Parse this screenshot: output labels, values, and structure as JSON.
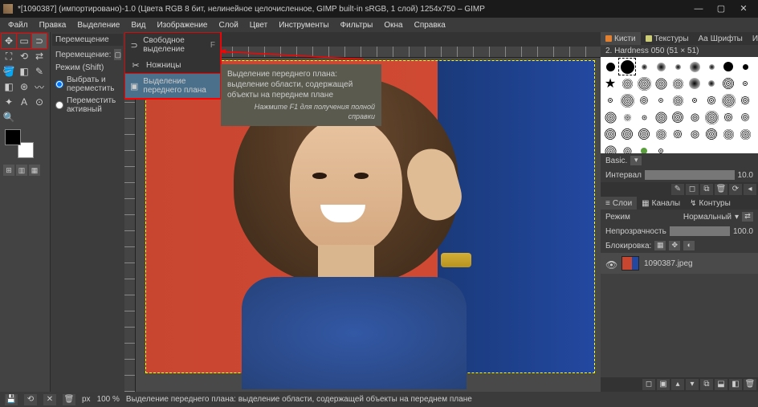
{
  "title": "*[1090387] (импортировано)-1.0 (Цвета RGB 8 бит, нелинейное целочисленное, GIMP built-in sRGB, 1 слой) 1254x750 – GIMP",
  "menu": [
    "Файл",
    "Правка",
    "Выделение",
    "Вид",
    "Изображение",
    "Слой",
    "Цвет",
    "Инструменты",
    "Фильтры",
    "Окна",
    "Справка"
  ],
  "dockleft": {
    "title": "Перемещение",
    "row1": "Перемещение:",
    "mode": "Режим (Shift)",
    "opt1": "Выбрать и переместить",
    "opt2": "Переместить активный"
  },
  "selmenu": [
    {
      "icon": "⌖",
      "label": "Свободное выделение",
      "kb": "F"
    },
    {
      "icon": "✂",
      "label": "Ножницы",
      "kb": ""
    },
    {
      "icon": "▣",
      "label": "Выделение переднего плана",
      "kb": ""
    }
  ],
  "tooltip": {
    "line1": "Выделение переднего плана: выделение области, содержащей объекты на переднем плане",
    "line2": "Нажмите F1 для получения полной справки"
  },
  "tabsTop": [
    "Кисти",
    "Текстуры",
    "Шрифты",
    "История"
  ],
  "brushInfo": "2. Hardness 050 (51 × 51)",
  "basic": "Basic.",
  "interval": {
    "label": "Интервал",
    "value": "10.0"
  },
  "tabsMid": [
    "Слои",
    "Каналы",
    "Контуры"
  ],
  "mode": {
    "label": "Режим",
    "value": "Нормальный"
  },
  "opacity": {
    "label": "Непрозрачность",
    "value": "100.0"
  },
  "lock": "Блокировка:",
  "layer": "1090387.jpeg",
  "status": {
    "zoom": "100 %",
    "text": "Выделение переднего плана: выделение области, содержащей объекты на переднем плане",
    "px": "px"
  }
}
